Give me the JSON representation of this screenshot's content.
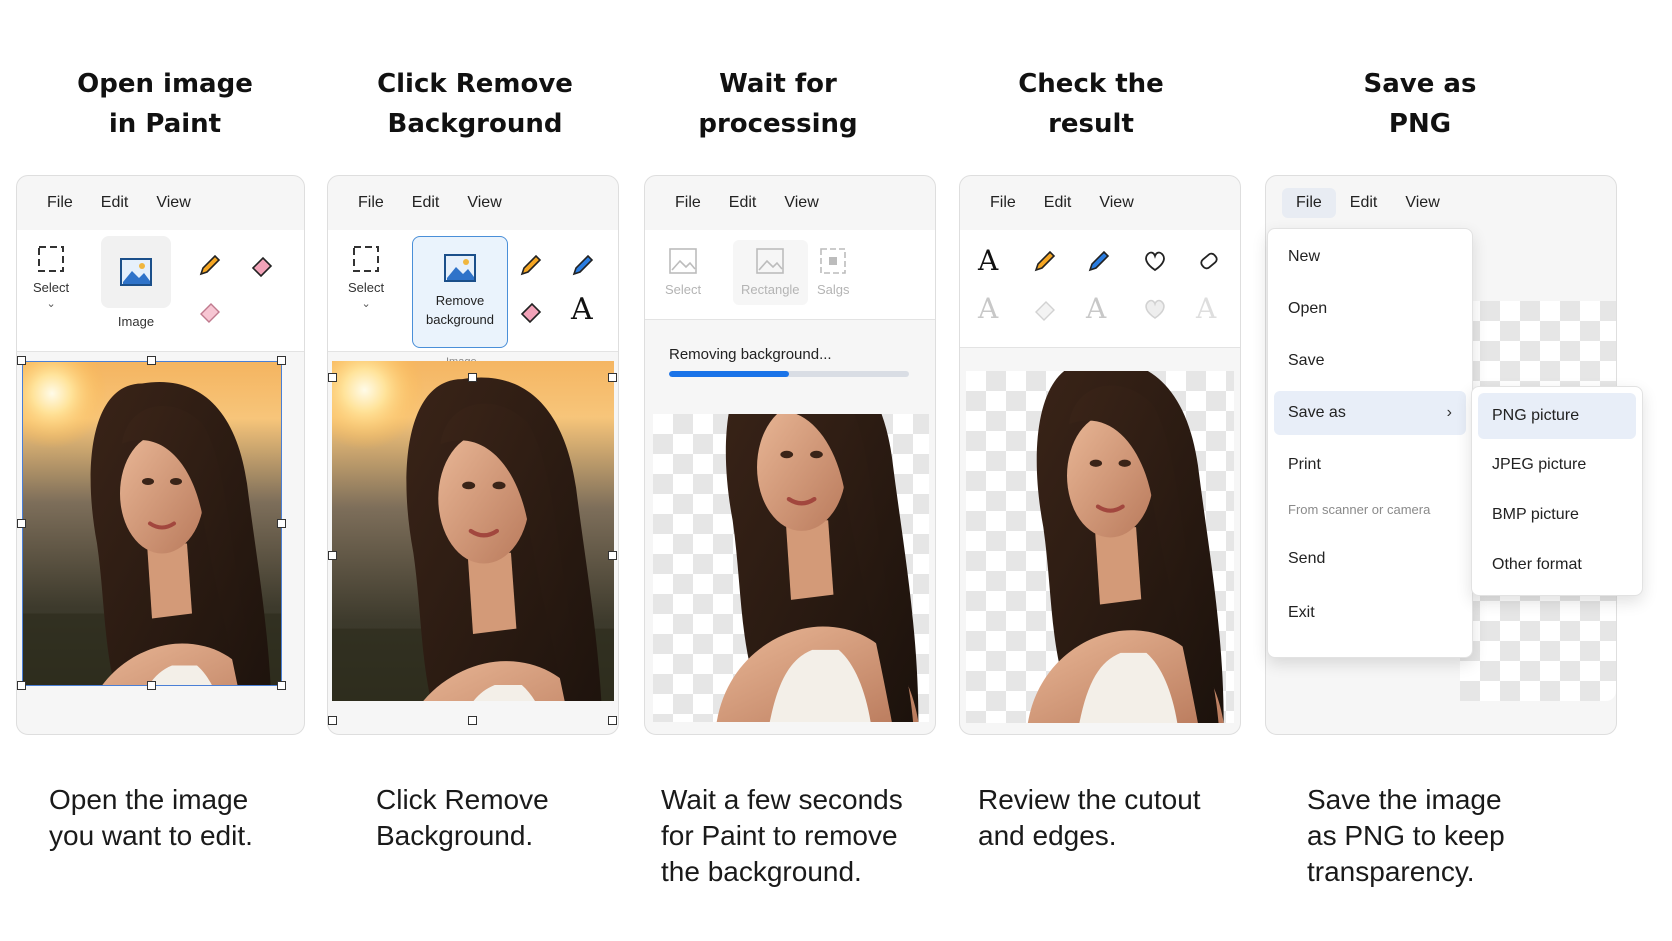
{
  "steps": [
    {
      "title": "Open image\nin Paint",
      "caption": "Open the image\nyou want to edit."
    },
    {
      "title": "Click Remove\nBackground",
      "caption": "Click Remove\nBackground."
    },
    {
      "title": "Wait for\nprocessing",
      "caption": "Wait a few seconds\nfor Paint to remove\nthe background."
    },
    {
      "title": "Check the\nresult",
      "caption": "Review the cutout\nand edges."
    },
    {
      "title": "Save as\nPNG",
      "caption": "Save the image\nas PNG to keep\ntransparency."
    }
  ],
  "menu": {
    "file": "File",
    "edit": "Edit",
    "view": "View"
  },
  "panel1": {
    "select_label": "Select",
    "image_label": "Image"
  },
  "panel2": {
    "select_label": "Select",
    "remove_bg_label": "Remove\nbackground",
    "group_label": "Image"
  },
  "panel3": {
    "select_label": "Select",
    "rectangle_label": "Rectangle",
    "salgs_label": "Salgs",
    "progress_label": "Removing background...",
    "progress": 0.5
  },
  "file_menu": {
    "items": [
      "New",
      "Open",
      "Save",
      "Save as",
      "Print",
      "From scanner or camera",
      "Send",
      "Exit"
    ],
    "submenu": [
      "PNG picture",
      "JPEG picture",
      "BMP picture",
      "Other format"
    ]
  },
  "colors": {
    "accent": "#1a73e8",
    "selection": "#4a7fd6",
    "highlight": "#e8eef8"
  }
}
